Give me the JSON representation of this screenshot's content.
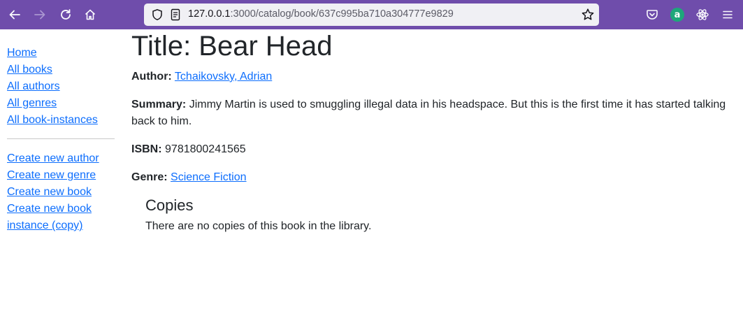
{
  "browser": {
    "url_host": "127.0.0.1",
    "url_rest": ":3000/catalog/book/637c995ba710a304777e9829",
    "badge_letter": "a",
    "icons": [
      "back-arrow-icon",
      "forward-arrow-icon",
      "reload-icon",
      "home-icon",
      "shield-icon",
      "page-info-icon",
      "bookmark-star-icon",
      "pocket-icon",
      "extension-badge-icon",
      "react-devtools-icon",
      "hamburger-menu-icon"
    ],
    "colors": {
      "toolbar": "#6f4dab",
      "urlbar": "#f0f0f4",
      "link": "#0d6efd"
    }
  },
  "sidebar": {
    "nav": [
      {
        "label": "Home"
      },
      {
        "label": "All books"
      },
      {
        "label": "All authors"
      },
      {
        "label": "All genres"
      },
      {
        "label": "All book-instances"
      }
    ],
    "create": [
      {
        "label": "Create new author"
      },
      {
        "label": "Create new genre"
      },
      {
        "label": "Create new book"
      },
      {
        "label": "Create new book instance (copy)"
      }
    ]
  },
  "book": {
    "title": "Title: Bear Head",
    "author_label": "Author:",
    "author": "Tchaikovsky, Adrian",
    "summary_label": "Summary:",
    "summary": "Jimmy Martin is used to smuggling illegal data in his headspace. But this is the first time it has started talking back to him.",
    "isbn_label": "ISBN:",
    "isbn": "9781800241565",
    "genre_label": "Genre:",
    "genre": "Science Fiction"
  },
  "copies": {
    "heading": "Copies",
    "empty_message": "There are no copies of this book in the library."
  }
}
